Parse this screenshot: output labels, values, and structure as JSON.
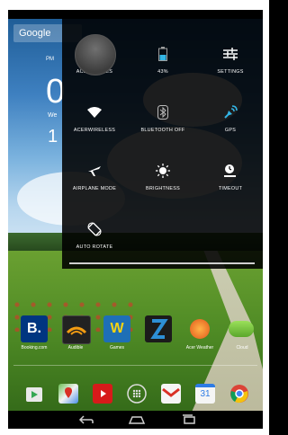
{
  "home": {
    "search_label": "Google",
    "clock_ampm": "PM",
    "clock_time": "0",
    "clock_day": "We",
    "clock_date": "1"
  },
  "quick_settings": {
    "tiles": [
      {
        "label": "ACER GUIDES",
        "icon": "avatar-icon"
      },
      {
        "label": "43%",
        "icon": "battery-icon"
      },
      {
        "label": "SETTINGS",
        "icon": "settings-sliders-icon"
      },
      {
        "label": "ACERWIRELESS",
        "icon": "wifi-icon"
      },
      {
        "label": "BLUETOOTH OFF",
        "icon": "bluetooth-icon"
      },
      {
        "label": "GPS",
        "icon": "gps-icon"
      },
      {
        "label": "AIRPLANE MODE",
        "icon": "airplane-icon"
      },
      {
        "label": "BRIGHTNESS",
        "icon": "brightness-icon"
      },
      {
        "label": "TIMEOUT",
        "icon": "timeout-icon"
      },
      {
        "label": "AUTO ROTATE",
        "icon": "rotate-icon"
      }
    ],
    "battery_level": 0.43,
    "accent_color": "#33b5e5"
  },
  "apps": [
    {
      "label": "Booking.com",
      "icon": "booking-icon"
    },
    {
      "label": "Audible",
      "icon": "audible-icon"
    },
    {
      "label": "Games",
      "icon": "wordsearch-icon"
    },
    {
      "label": "",
      "icon": "zinio-icon"
    },
    {
      "label": "Acer Weather",
      "icon": "weather-icon"
    },
    {
      "label": "Cloud",
      "icon": "cloud-icon"
    }
  ],
  "dock": [
    {
      "icon": "play-store-icon"
    },
    {
      "icon": "maps-icon"
    },
    {
      "icon": "youtube-icon"
    },
    {
      "icon": "app-drawer-icon"
    },
    {
      "icon": "gmail-icon"
    },
    {
      "label": "31",
      "icon": "calendar-icon"
    },
    {
      "icon": "chrome-icon"
    }
  ]
}
